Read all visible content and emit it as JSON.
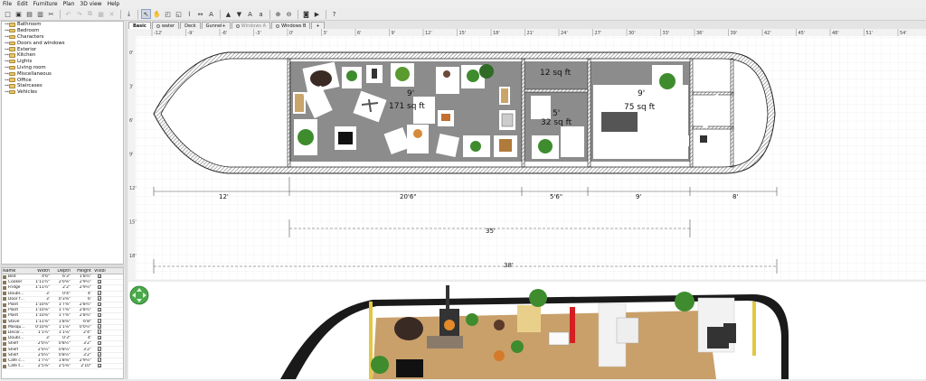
{
  "menu": [
    "File",
    "Edit",
    "Furniture",
    "Plan",
    "3D view",
    "Help"
  ],
  "catalog": {
    "categories": [
      "Bathroom",
      "Bedroom",
      "Characters",
      "Doors and windows",
      "Exterior",
      "Kitchen",
      "Lights",
      "Living room",
      "Miscellaneous",
      "Office",
      "Staircases",
      "Vehicles"
    ]
  },
  "furniture_table": {
    "headers": {
      "name": "Name",
      "width": "Width",
      "depth": "Depth",
      "height": "Height",
      "visible": "Visible"
    },
    "rows": [
      {
        "name": "Bed",
        "width": "4'6\"",
        "depth": "6'3\"",
        "height": "1'8¾\""
      },
      {
        "name": "Cooker",
        "width": "1'11¾\"",
        "depth": "2'0⅝\"",
        "height": "2'9½\""
      },
      {
        "name": "Fridge",
        "width": "1'11¾\"",
        "depth": "2'2\"",
        "height": "2'9½\""
      },
      {
        "name": "Doubl…",
        "width": "3'",
        "depth": "0'4\"",
        "height": "4'"
      },
      {
        "name": "Door f…",
        "width": "3'",
        "depth": "0'3⅜\"",
        "height": "6'"
      },
      {
        "name": "Plant",
        "width": "1'10⅝\"",
        "depth": "1'7⅜\"",
        "height": "2'8¾\""
      },
      {
        "name": "Plant",
        "width": "1'10⅝\"",
        "depth": "1'7⅜\"",
        "height": "2'8¾\""
      },
      {
        "name": "Plant",
        "width": "1'10⅝\"",
        "depth": "1'7⅜\"",
        "height": "2'8¾\""
      },
      {
        "name": "Stove",
        "width": "1'11⅝\"",
        "depth": "1'8⅜\"",
        "height": "6'8\""
      },
      {
        "name": "Mosqu…",
        "width": "0'10⅜\"",
        "depth": "1'1⅛\"",
        "height": "0'0½\""
      },
      {
        "name": "Decor…",
        "width": "1'1¾\"",
        "depth": "1'1⅛\"",
        "height": "2'4\""
      },
      {
        "name": "Doubl…",
        "width": "3'",
        "depth": "0'3\"",
        "height": "4'"
      },
      {
        "name": "Shelf",
        "width": "2'0½\"",
        "depth": "0'8½\"",
        "height": "3'2\""
      },
      {
        "name": "Shelf",
        "width": "2'0½\"",
        "depth": "0'8½\"",
        "height": "3'2\""
      },
      {
        "name": "Shelf",
        "width": "2'0½\"",
        "depth": "0'8½\"",
        "height": "3'2\""
      },
      {
        "name": "Cafe c…",
        "width": "1'7½\"",
        "depth": "1'8⅝\"",
        "height": "2'9½\""
      },
      {
        "name": "Cafe t…",
        "width": "2'5⅜\"",
        "depth": "2'5⅜\"",
        "height": "2'10\""
      }
    ]
  },
  "tabs": [
    "Basic",
    "water",
    "Deck",
    "Gunnel+",
    "Windows A",
    "Windows B",
    "+"
  ],
  "ruler": {
    "top": [
      "-12'",
      "-9'",
      "-6'",
      "-3'",
      "0'",
      "3'",
      "6'",
      "9'",
      "12'",
      "15'",
      "18'",
      "21'",
      "24'",
      "27'",
      "30'",
      "33'",
      "36'",
      "39'",
      "42'",
      "45'",
      "48'",
      "51'",
      "54'"
    ],
    "left": [
      "0'",
      "3'",
      "6'",
      "9'",
      "12'",
      "15'",
      "18'"
    ]
  },
  "plan": {
    "rooms": [
      {
        "label": "9'",
        "area": "171 sq ft"
      },
      {
        "label": "12 sq ft",
        "area": ""
      },
      {
        "label": "5'",
        "area": "32 sq ft"
      },
      {
        "label": "9'",
        "area": "75 sq ft"
      }
    ],
    "dimensions": {
      "row1": [
        "12'",
        "20'6\"",
        "5'6\"",
        "9'",
        "8'"
      ],
      "row2": "35'",
      "row3": "38'"
    }
  },
  "colors": {
    "accent": "#3b6fb6",
    "floor": "#8c8c8c",
    "wall": "#222222",
    "plant": "#3e8c2e"
  }
}
